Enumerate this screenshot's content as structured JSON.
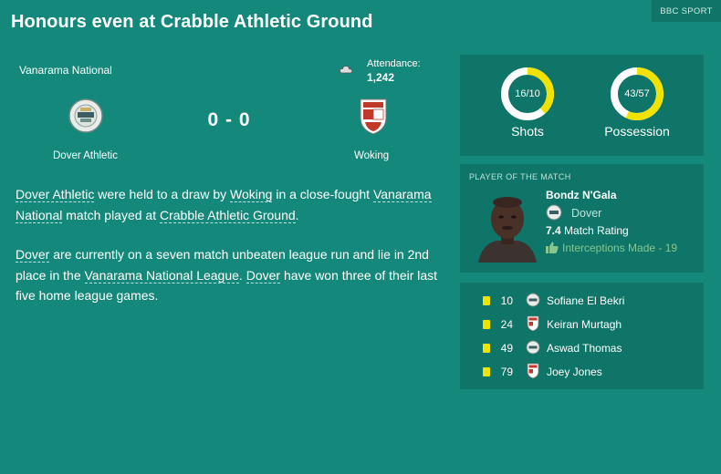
{
  "header": {
    "title": "Honours even at Crabble Athletic Ground",
    "badge": "BBC SPORT"
  },
  "match": {
    "competition": "Vanarama National",
    "attendance_label": "Attendance:",
    "attendance": "1,242",
    "score": "0 - 0",
    "home_team": "Dover Athletic",
    "away_team": "Woking",
    "weather_icon": "cloud-icon"
  },
  "summary": {
    "p1": {
      "t1": "Dover Athletic",
      "t2": " were held to a draw by ",
      "t3": "Woking",
      "t4": " in a close-fought ",
      "t5": "Vanarama National",
      "t6": " match played at ",
      "t7": "Crabble Athletic Ground",
      "t8": "."
    },
    "p2": {
      "t1": "Dover",
      "t2": " are currently on a seven match unbeaten league run and lie in 2nd place in the ",
      "t3": "Vanarama National League",
      "t4": ". ",
      "t5": "Dover",
      "t6": " have won three of their last five home league games."
    }
  },
  "stats": {
    "shots": {
      "value": "16/10",
      "label": "Shots",
      "home": 16,
      "away": 10
    },
    "possession": {
      "value": "43/57",
      "label": "Possession",
      "home": 43,
      "away": 57
    }
  },
  "potm": {
    "heading": "PLAYER OF THE MATCH",
    "name": "Bondz N'Gala",
    "team": "Dover",
    "rating": "7.4",
    "rating_label": " Match Rating",
    "stat": "Interceptions Made - 19"
  },
  "bookings": [
    {
      "num": "10",
      "name": "Sofiane El Bekri",
      "team": "home"
    },
    {
      "num": "24",
      "name": "Keiran Murtagh",
      "team": "away"
    },
    {
      "num": "49",
      "name": "Aswad Thomas",
      "team": "home"
    },
    {
      "num": "79",
      "name": "Joey Jones",
      "team": "away"
    }
  ],
  "colors": {
    "background": "#14887a",
    "panel": "#0f7568",
    "donut_accent": "#f1e300",
    "card": "#f1e300",
    "positive": "#86c78f"
  }
}
